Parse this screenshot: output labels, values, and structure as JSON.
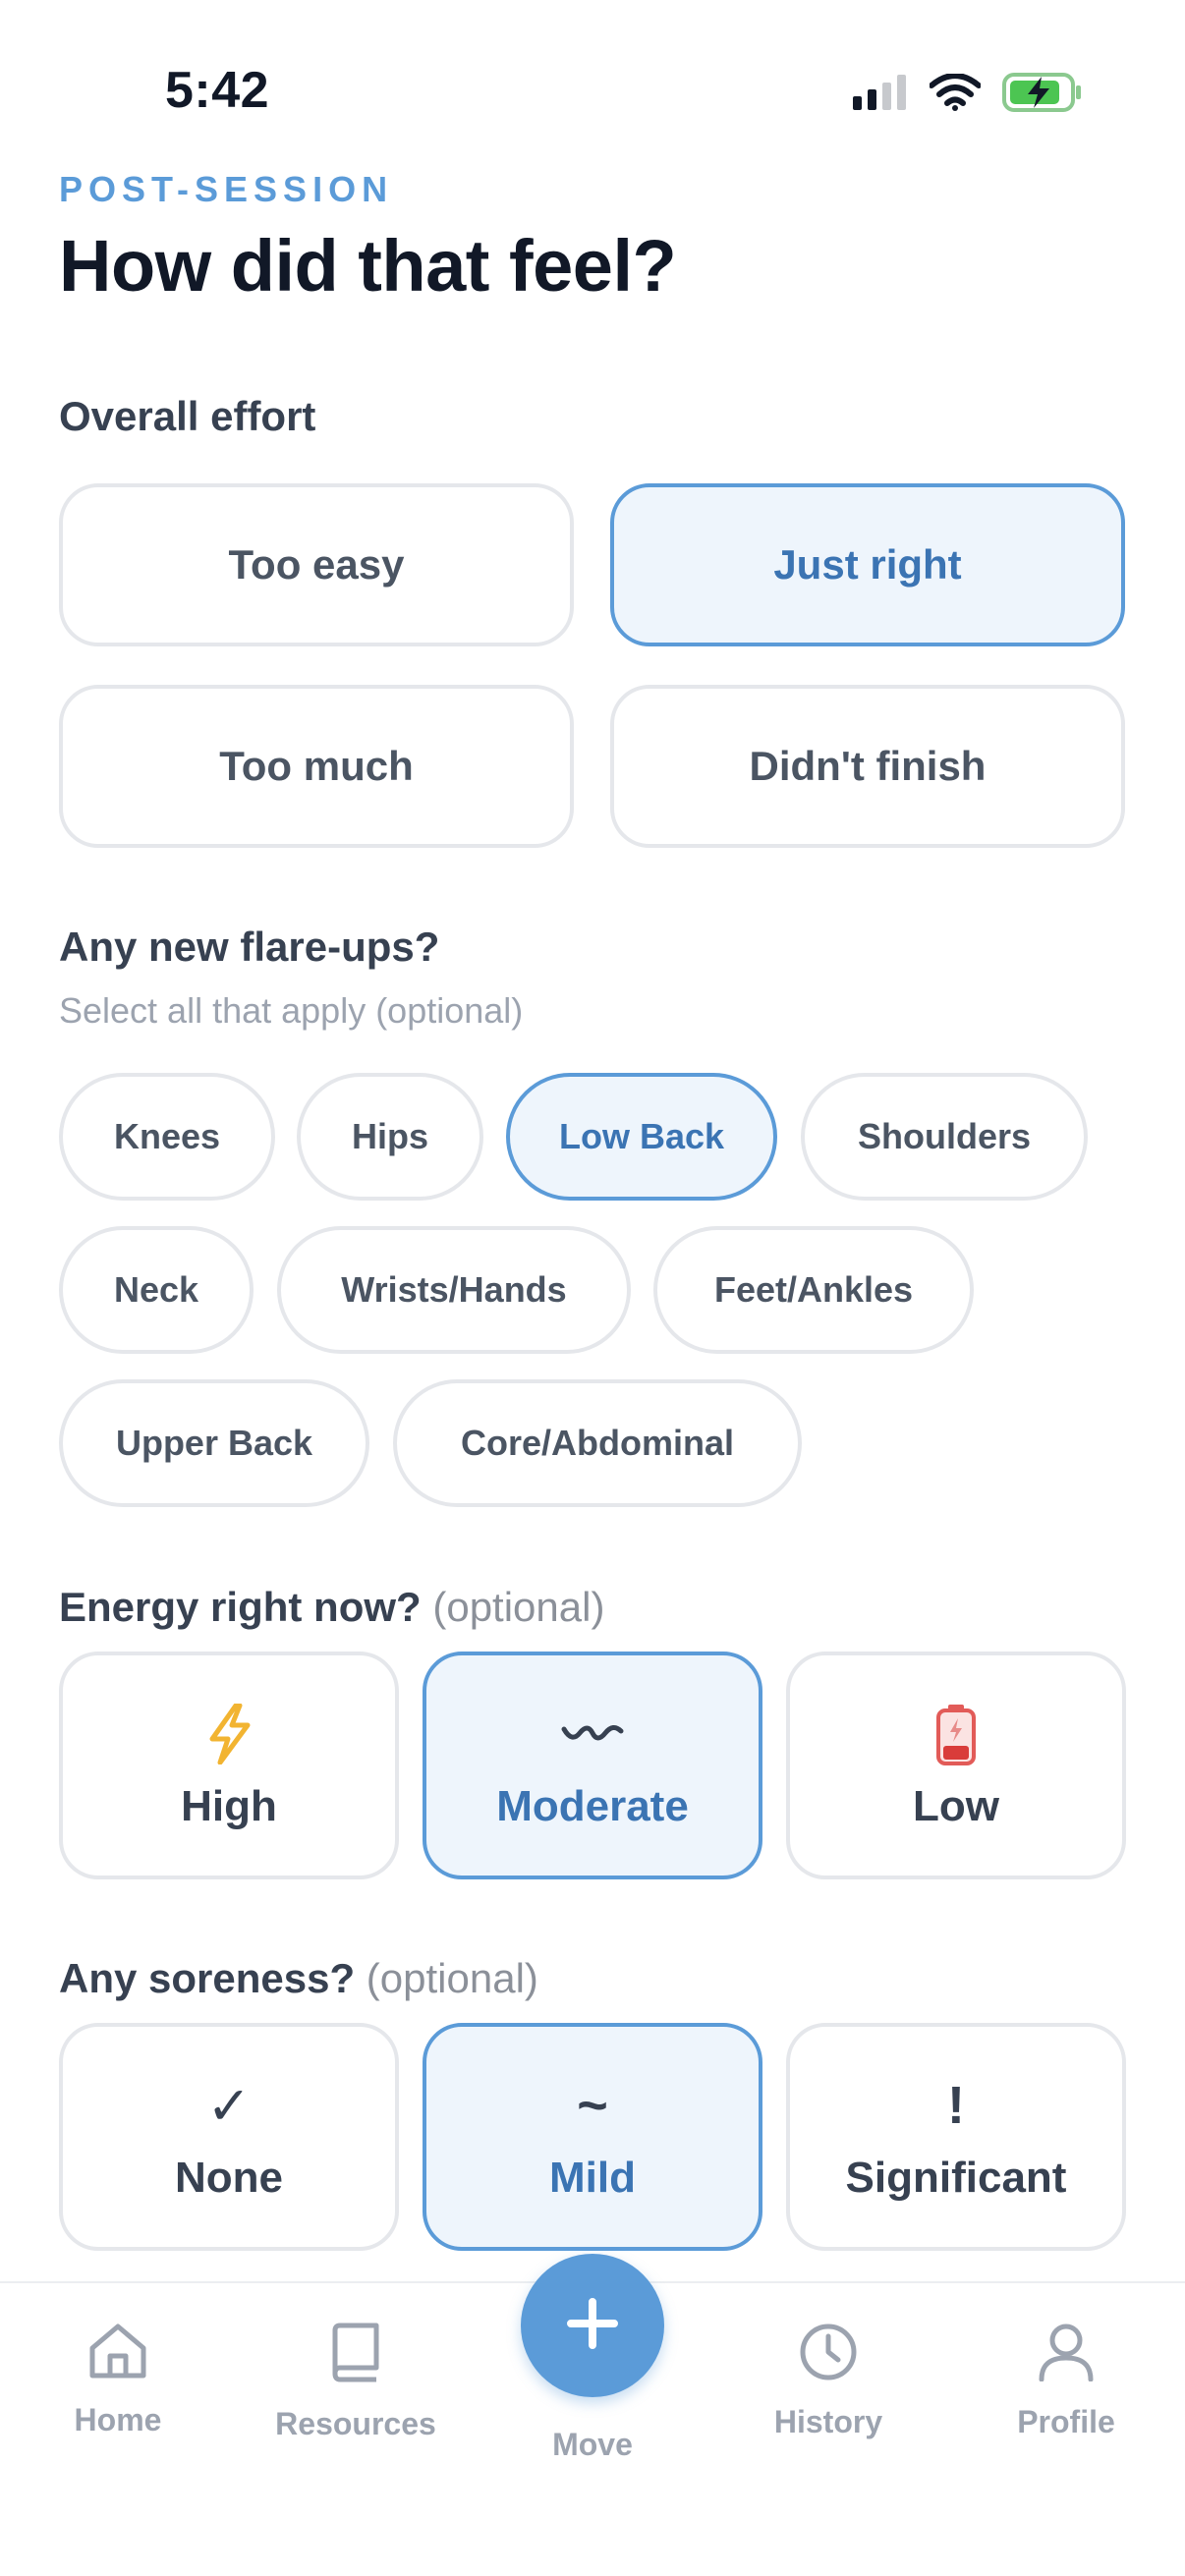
{
  "status_bar": {
    "time": "5:42"
  },
  "header": {
    "eyebrow": "POST-SESSION",
    "title": "How did that feel?"
  },
  "effort": {
    "label": "Overall effort",
    "options": [
      "Too easy",
      "Just right",
      "Too much",
      "Didn't finish"
    ],
    "selected": "Just right"
  },
  "flareups": {
    "label": "Any new flare-ups?",
    "sublabel": "Select all that apply (optional)",
    "options": [
      "Knees",
      "Hips",
      "Low Back",
      "Shoulders",
      "Neck",
      "Wrists/Hands",
      "Feet/Ankles",
      "Upper Back",
      "Core/Abdominal"
    ],
    "selected": [
      "Low Back"
    ]
  },
  "energy": {
    "label": "Energy right now?",
    "optional": "(optional)",
    "options": [
      {
        "label": "High",
        "icon": "lightning-icon"
      },
      {
        "label": "Moderate",
        "icon": "wave-icon"
      },
      {
        "label": "Low",
        "icon": "low-battery-icon"
      }
    ],
    "selected": "Moderate"
  },
  "soreness": {
    "label": "Any soreness?",
    "optional": "(optional)",
    "options": [
      {
        "label": "None",
        "symbol": "✓"
      },
      {
        "label": "Mild",
        "symbol": "~"
      },
      {
        "label": "Significant",
        "symbol": "!"
      }
    ],
    "selected": "Mild"
  },
  "nav": {
    "home": "Home",
    "resources": "Resources",
    "move": "Move",
    "history": "History",
    "profile": "Profile"
  },
  "colors": {
    "accent": "#5b9bd8",
    "selected_bg": "#eef5fc",
    "selected_text": "#3b74b3",
    "border": "#e5e7eb"
  }
}
